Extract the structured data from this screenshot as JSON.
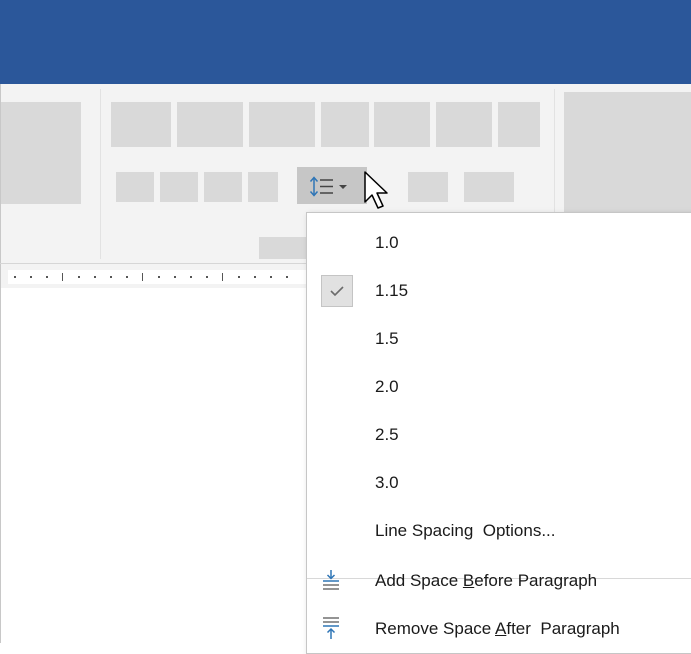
{
  "line_spacing_button": {
    "icon": "line-spacing-icon",
    "dropdown_icon": "chevron-down-icon"
  },
  "menu": {
    "items": [
      {
        "label": "1.0",
        "checked": false
      },
      {
        "label": "1.15",
        "checked": true
      },
      {
        "label": "1.5",
        "checked": false
      },
      {
        "label": "2.0",
        "checked": false
      },
      {
        "label": "2.5",
        "checked": false
      },
      {
        "label": "3.0",
        "checked": false
      }
    ],
    "options_label": "Line Spacing  Options...",
    "add_space": {
      "pre": "Add Space ",
      "key": "B",
      "post": "efore Paragraph"
    },
    "remove_space": {
      "pre": "Remove Space ",
      "key": "A",
      "post": "fter  Paragraph"
    }
  },
  "colors": {
    "titlebar": "#2b579a",
    "ribbon": "#f3f3f3",
    "accent_icon": "#2e75b6"
  }
}
